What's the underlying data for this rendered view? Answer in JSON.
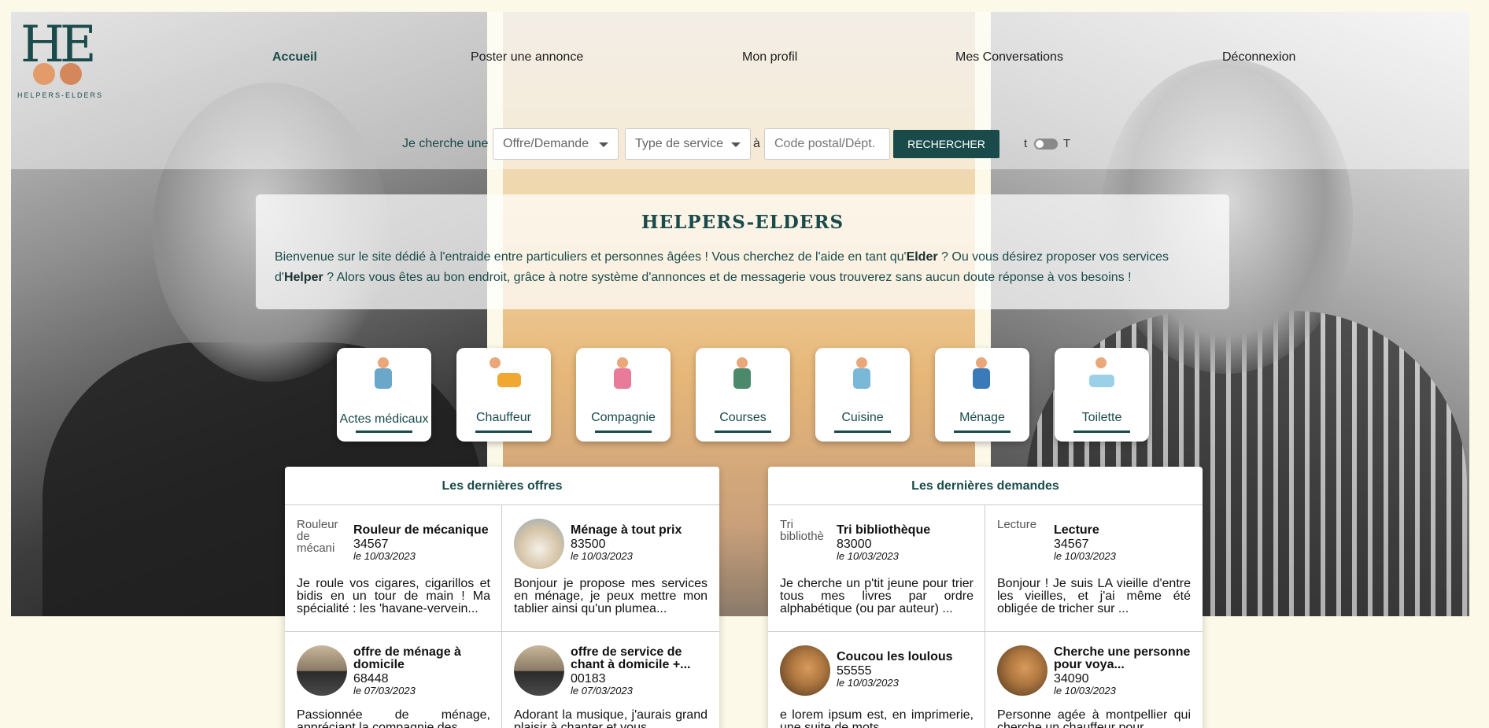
{
  "logo": {
    "letters": "HE",
    "name": "HELPERS-ELDERS"
  },
  "nav": {
    "items": [
      {
        "label": "Accueil",
        "active": true
      },
      {
        "label": "Poster une annonce"
      },
      {
        "label": "Mon profil"
      },
      {
        "label": "Mes Conversations"
      },
      {
        "label": "Déconnexion"
      }
    ]
  },
  "search": {
    "label": "Je cherche une",
    "offer_select": "Offre/Demande",
    "type_select": "Type de service",
    "a": "à",
    "zip_placeholder": "Code postal/Dépt.",
    "button": "RECHERCHER",
    "toggle_left": "t",
    "toggle_right": "T"
  },
  "intro": {
    "title": "HELPERS-ELDERS",
    "text1": "Bienvenue sur le site dédié à l'entraide entre particuliers et personnes âgées ! Vous cherchez de l'aide en tant qu'",
    "elder": "Elder",
    "text2": " ? Ou vous désirez proposer vos services d'",
    "helper": "Helper",
    "text3": " ? Alors vous êtes au bon endroit, grâce à notre système d'annonces et de messagerie vous trouverez sans aucun doute réponse à vos besoins !"
  },
  "categories": [
    {
      "label": "Actes médicaux",
      "icon": "medical-icon"
    },
    {
      "label": "Chauffeur",
      "icon": "car-icon"
    },
    {
      "label": "Compagnie",
      "icon": "company-icon"
    },
    {
      "label": "Courses",
      "icon": "shopping-icon"
    },
    {
      "label": "Cuisine",
      "icon": "cooking-icon"
    },
    {
      "label": "Ménage",
      "icon": "cleaning-icon"
    },
    {
      "label": "Toilette",
      "icon": "bath-icon"
    }
  ],
  "offers": {
    "title": "Les dernières offres",
    "cards": [
      {
        "title": "Rouleur de mécanique",
        "zip": "34567",
        "date": "le 10/03/2023",
        "alt": "Rouleur de mécani",
        "desc": "Je roule vos cigares, cigarillos et bidis en un tour de main ! Ma spécialité : les 'havane-vervein..."
      },
      {
        "title": "Ménage à tout prix",
        "zip": "83500",
        "date": "le 10/03/2023",
        "desc": "Bonjour je propose mes services en ménage, je peux mettre mon tablier ainsi qu'un plumea..."
      },
      {
        "title": "offre de ménage à domicile",
        "zip": "68448",
        "date": "le 07/03/2023",
        "desc": "Passionnée de ménage, appréciant la compagnie des"
      },
      {
        "title": "offre de service de chant à domicile +...",
        "zip": "00183",
        "date": "le 07/03/2023",
        "desc": "Adorant la musique, j'aurais grand plaisir à chanter et vous"
      }
    ]
  },
  "demands": {
    "title": "Les dernières demandes",
    "cards": [
      {
        "title": "Tri bibliothèque",
        "zip": "83000",
        "date": "le 10/03/2023",
        "alt": "Tri bibliothè",
        "desc": "Je cherche un p'tit jeune pour trier tous mes livres par ordre alphabétique (ou par auteur) ..."
      },
      {
        "title": "Lecture",
        "zip": "34567",
        "date": "le 10/03/2023",
        "alt": "Lecture",
        "desc": "Bonjour ! Je suis LA vieille d'entre les vieilles, et j'ai même été obligée de tricher sur ..."
      },
      {
        "title": "Coucou les loulous",
        "zip": "55555",
        "date": "le 10/03/2023",
        "desc": "e lorem ipsum est, en imprimerie, une suite de mots"
      },
      {
        "title": "Cherche une personne pour voya...",
        "zip": "34090",
        "date": "le 10/03/2023",
        "desc": "Personne agée à montpellier qui cherche un chauffeur pour"
      }
    ]
  }
}
